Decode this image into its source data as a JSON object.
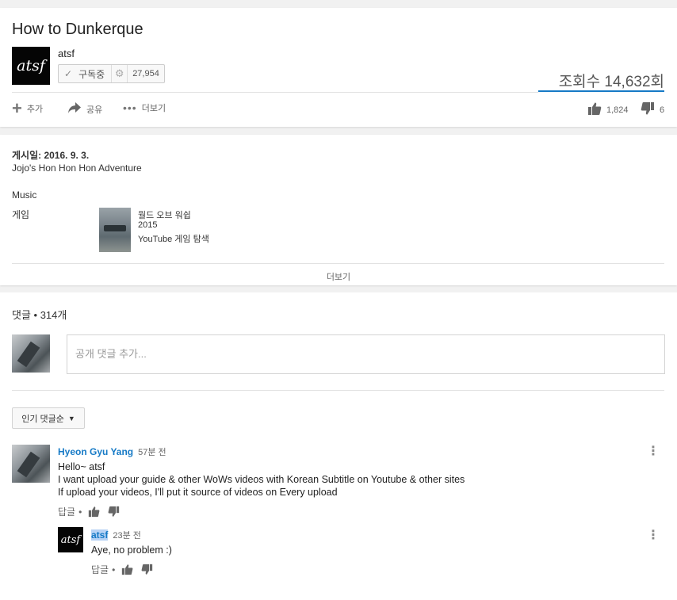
{
  "video": {
    "title": "How to Dunkerque",
    "channel": {
      "avatar_text": "atsf",
      "name": "atsf",
      "subscribe_label": "구독중",
      "subscriber_count": "27,954"
    },
    "view_count": "조회수 14,632회",
    "actions": {
      "add_label": "추가",
      "share_label": "공유",
      "more_label": "더보기"
    },
    "like_count": "1,824",
    "dislike_count": "6"
  },
  "description": {
    "published": "게시일: 2016. 9. 3.",
    "body": "Jojo's Hon Hon Hon Adventure",
    "category": "Music",
    "game_label": "게임",
    "game": {
      "name": "월드 오브 워쉽",
      "year": "2015",
      "explore": "YouTube 게임 탐색"
    },
    "show_more": "더보기"
  },
  "comments": {
    "header": "댓글 • 314개",
    "input_placeholder": "공개 댓글 추가...",
    "sort_label": "인기 댓글순",
    "items": [
      {
        "author": "Hyeon Gyu Yang",
        "time": "57분 전",
        "lines": [
          "Hello~ atsf",
          "I want upload your guide & other WoWs videos with Korean Subtitle on Youtube & other sites",
          "If upload your videos, I'll put it source of videos on Every upload"
        ],
        "reply_label": "답글"
      }
    ],
    "reply": {
      "avatar_text": "atsf",
      "author": "atsf",
      "time": "23분 전",
      "text": "Aye, no problem :)",
      "reply_label": "답글"
    }
  },
  "colors": {
    "accent": "#167ac6",
    "background": "#f1f1f1",
    "card": "#ffffff"
  },
  "icons": [
    "check-icon",
    "gear-icon",
    "plus-icon",
    "share-icon",
    "more-dots-icon",
    "thumbs-up-icon",
    "thumbs-down-icon",
    "caret-down-icon",
    "kebab-menu-icon"
  ]
}
